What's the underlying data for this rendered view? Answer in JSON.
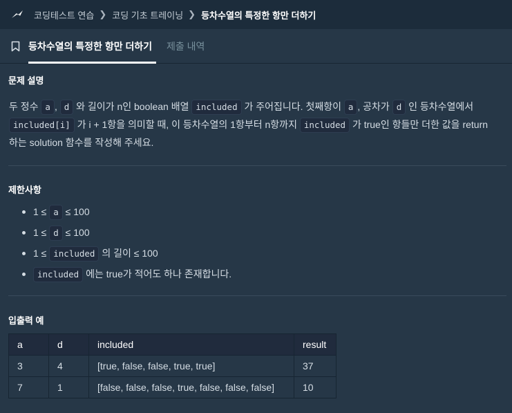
{
  "breadcrumb": {
    "items": [
      "코딩테스트 연습",
      "코딩 기초 트레이닝"
    ],
    "current": "등차수열의 특정한 항만 더하기"
  },
  "tabs": {
    "active": "등차수열의 특정한 항만 더하기",
    "inactive": "제출 내역"
  },
  "problem": {
    "heading": "문제 설명",
    "p1": "두 정수 ",
    "c_a1": "a",
    "p2": ", ",
    "c_d1": "d",
    "p3": " 와 길이가 n인 boolean 배열 ",
    "c_inc1": "included",
    "p4": " 가 주어집니다. 첫째항이 ",
    "c_a2": "a",
    "p5": ", 공차가 ",
    "c_d2": "d",
    "p6": " 인 등차수열에서",
    "c_inc2": "included[i]",
    "p7": " 가 i + 1항을 의미할 때, 이 등차수열의 1항부터 n항까지 ",
    "c_inc3": "included",
    "p8": " 가 true인 항들만 더한 값을 return",
    "p9": "하는 solution 함수를 작성해 주세요."
  },
  "constraints": {
    "heading": "제한사항",
    "c1_pre": "1 ≤ ",
    "c1_code": "a",
    "c1_post": " ≤ 100",
    "c2_pre": "1 ≤ ",
    "c2_code": "d",
    "c2_post": " ≤ 100",
    "c3_pre": "1 ≤ ",
    "c3_code": "included",
    "c3_post": " 의 길이 ≤ 100",
    "c4_code": "included",
    "c4_post": " 에는 true가 적어도 하나 존재합니다."
  },
  "examples": {
    "heading": "입출력 예",
    "headers": [
      "a",
      "d",
      "included",
      "result"
    ],
    "rows": [
      [
        "3",
        "4",
        "[true, false, false, true, true]",
        "37"
      ],
      [
        "7",
        "1",
        "[false, false, false, true, false, false, false]",
        "10"
      ]
    ]
  },
  "icons": {
    "logo": "programmers-logo-icon",
    "breadcrumb_separator": "chevron-right-icon",
    "tab": "bookmark-icon"
  },
  "colors": {
    "background": "#263747",
    "topbar": "#1c2c3b",
    "code_bg": "#202b3d",
    "text": "#d5dde4",
    "muted": "#78909c"
  }
}
